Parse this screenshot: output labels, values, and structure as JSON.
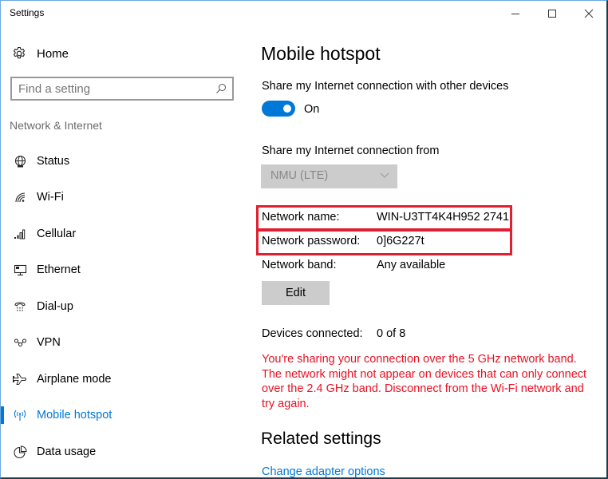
{
  "window": {
    "title": "Settings",
    "controls": [
      "minimize",
      "maximize",
      "close"
    ]
  },
  "sidebar": {
    "home_label": "Home",
    "search": {
      "placeholder": "Find a setting",
      "value": ""
    },
    "section_label": "Network & Internet",
    "items": [
      {
        "label": "Status",
        "icon": "globe-icon",
        "active": false
      },
      {
        "label": "Wi-Fi",
        "icon": "wifi-icon",
        "active": false
      },
      {
        "label": "Cellular",
        "icon": "cellular-signal-icon",
        "active": false
      },
      {
        "label": "Ethernet",
        "icon": "ethernet-icon",
        "active": false
      },
      {
        "label": "Dial-up",
        "icon": "phone-icon",
        "active": false
      },
      {
        "label": "VPN",
        "icon": "vpn-icon",
        "active": false
      },
      {
        "label": "Airplane mode",
        "icon": "airplane-icon",
        "active": false
      },
      {
        "label": "Mobile hotspot",
        "icon": "hotspot-icon",
        "active": true
      },
      {
        "label": "Data usage",
        "icon": "pie-chart-icon",
        "active": false
      }
    ]
  },
  "main": {
    "title": "Mobile hotspot",
    "share_label": "Share my Internet connection with other devices",
    "toggle": {
      "on": true,
      "state_label": "On"
    },
    "share_from_label": "Share my Internet connection from",
    "share_from_selected": "NMU (LTE)",
    "network_name": {
      "label": "Network name:",
      "value": "WIN-U3TT4K4H952 2741"
    },
    "network_password": {
      "label": "Network password:",
      "value": "0]6G227t"
    },
    "network_band": {
      "label": "Network band:",
      "value": "Any available"
    },
    "edit_button": "Edit",
    "devices_connected": {
      "label": "Devices connected:",
      "value": "0 of 8"
    },
    "warning": "You're sharing your connection over the 5 GHz network band. The network might not appear on devices that can only connect over the 2.4 GHz band. Disconnect from the Wi-Fi network and try again.",
    "related_title": "Related settings",
    "related_links": [
      "Change adapter options"
    ]
  },
  "colors": {
    "accent": "#0078d7",
    "warning": "#e81123",
    "highlight_box": "#e02030",
    "disabled_bg": "#cccccc"
  }
}
